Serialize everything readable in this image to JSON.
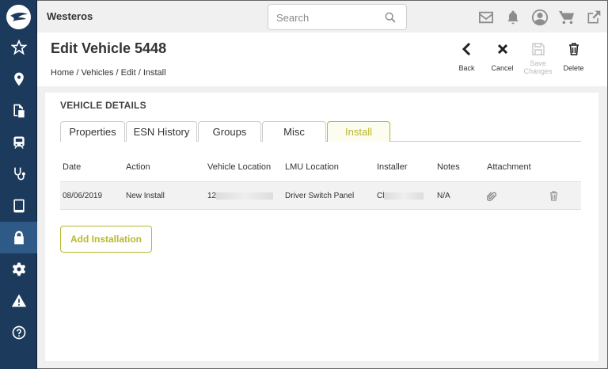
{
  "app": {
    "brand": "Westeros"
  },
  "search": {
    "placeholder": "Search"
  },
  "page": {
    "title": "Edit Vehicle 5448",
    "breadcrumb": [
      "Home",
      "Vehicles",
      "Edit",
      "Install"
    ]
  },
  "actions": {
    "back": "Back",
    "cancel": "Cancel",
    "save_line1": "Save",
    "save_line2": "Changes",
    "delete": "Delete"
  },
  "section": {
    "title": "VEHICLE DETAILS"
  },
  "tabs": [
    "Properties",
    "ESN History",
    "Groups",
    "Misc",
    "Install"
  ],
  "active_tab": "Install",
  "table": {
    "headers": [
      "Date",
      "Action",
      "Vehicle Location",
      "LMU Location",
      "Installer",
      "Notes",
      "Attachment"
    ],
    "rows": [
      {
        "date": "08/06/2019",
        "action": "New Install",
        "vehicle_location": "12",
        "lmu_location": "Driver Switch Panel",
        "installer": "Cl",
        "notes": "N/A"
      }
    ]
  },
  "add_button": "Add Installation",
  "colors": {
    "sidebar": "#1b3a5c",
    "accent": "#b8b82e"
  }
}
